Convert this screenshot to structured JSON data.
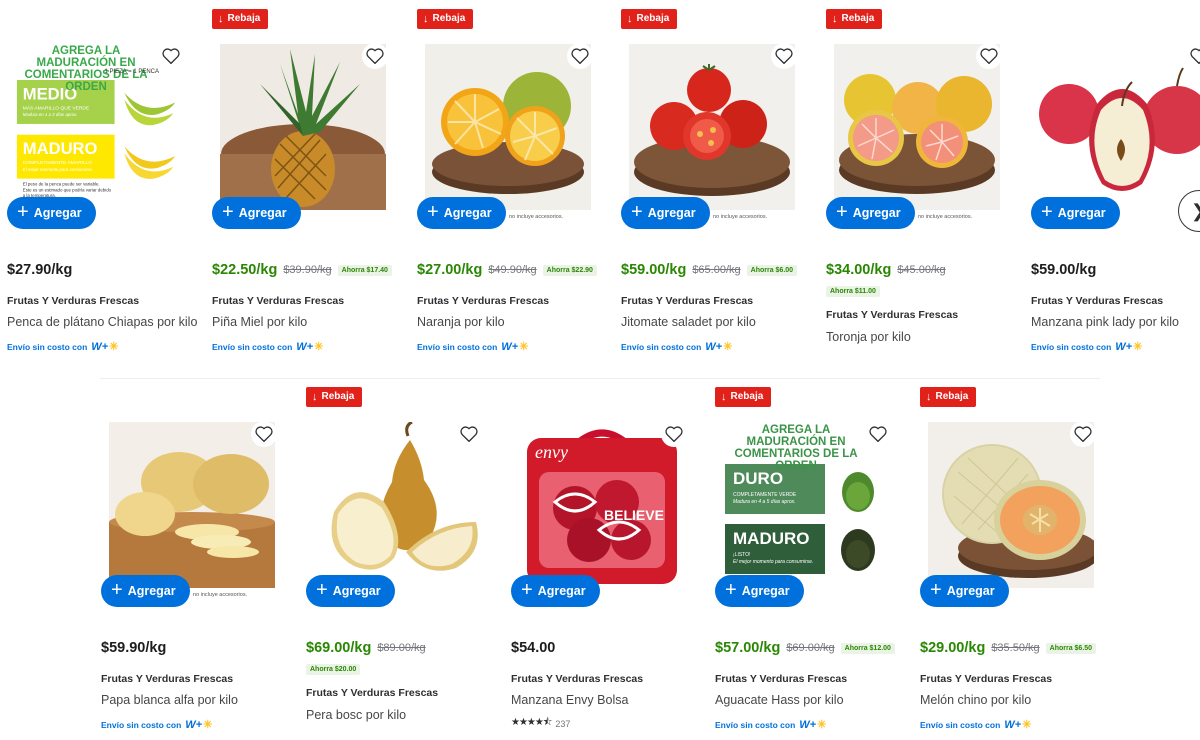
{
  "common": {
    "add_label": "Agregar",
    "sale_badge": "Rebaja",
    "accessories_note": "no incluye accesorios.",
    "category": "Frutas Y Verduras Frescas",
    "ship_label": "Envío sin costo con",
    "wp_text": "W+"
  },
  "products": [
    {
      "name": "Penca de plátano Chiapas por kilo",
      "price": "$27.90/kg",
      "was": "",
      "save": ""
    },
    {
      "name": "Piña Miel por kilo",
      "price": "$22.50/kg",
      "was": "$39.90/kg",
      "save": "Ahorra $17.40"
    },
    {
      "name": "Naranja por kilo",
      "price": "$27.00/kg",
      "was": "$49.90/kg",
      "save": "Ahorra $22.90"
    },
    {
      "name": "Jitomate saladet por kilo",
      "price": "$59.00/kg",
      "was": "$65.00/kg",
      "save": "Ahorra $6.00"
    },
    {
      "name": "Toronja por kilo",
      "price": "$34.00/kg",
      "was": "$45.00/kg",
      "save": "Ahorra $11.00"
    },
    {
      "name": "Manzana pink lady por kilo",
      "price": "$59.00/kg",
      "was": "",
      "save": ""
    },
    {
      "name": "Papa blanca alfa por kilo",
      "price": "$59.90/kg",
      "was": "",
      "save": ""
    },
    {
      "name": "Pera bosc por kilo",
      "price": "$69.00/kg",
      "was": "$89.00/kg",
      "save": "Ahorra $20.00"
    },
    {
      "name": "Manzana Envy Bolsa",
      "price": "$54.00",
      "was": "",
      "save": "",
      "rating_count": "237"
    },
    {
      "name": "Aguacate Hass por kilo",
      "price": "$57.00/kg",
      "was": "$69.00/kg",
      "save": "Ahorra $12.00"
    },
    {
      "name": "Melón chino por kilo",
      "price": "$29.00/kg",
      "was": "$35.50/kg",
      "save": "Ahorra $6.50"
    }
  ],
  "promo_banana": {
    "title": "AGREGA LA MADURACIÓN EN COMENTARIOS DE LA ORDEN",
    "note": "1 PIEZA = 1 PENCA",
    "level1": "MEDIO",
    "level1_desc": "MÁS AMARILLO QUE VERDE",
    "level1_sub": "Madura en 1 a 2 días aprox.",
    "level2": "MADURO",
    "level2_desc": "COMPLETAMENTE AMARILLO",
    "level2_sub": "El mejor momento para consumirse.",
    "footer": "El peso de la penca puede ser variable. Este es un estimado que podría variar debido a la temperatura."
  },
  "promo_avocado": {
    "title": "AGREGA LA MADURACIÓN EN COMENTARIOS DE LA ORDEN",
    "level1": "DURO",
    "level1_desc": "COMPLETAMENTE VERDE",
    "level1_sub": "Madura en 4 a 5 días aprox.",
    "level2": "MADURO",
    "level2_desc": "¡LISTO!",
    "level2_sub": "El mejor momento para consumirse."
  },
  "envy_bag_text": "envy",
  "colors": {
    "brand_blue": "#0071dc",
    "sale_red": "#e0221b",
    "sale_green": "#2a8703",
    "wp_yellow": "#ffc220"
  },
  "icons": {
    "heart": "heart-icon",
    "plus": "plus-icon",
    "arrow_down": "arrow-down-icon",
    "next": "chevron-right-icon",
    "star": "star-icon"
  },
  "rating": {
    "value": 4.5,
    "max": 5
  }
}
